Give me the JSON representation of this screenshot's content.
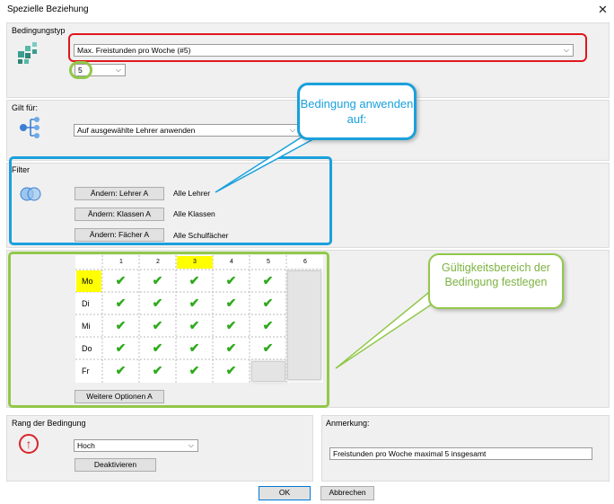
{
  "window": {
    "title": "Spezielle Beziehung",
    "close_glyph": "✕"
  },
  "bedingungstyp": {
    "label": "Bedingungstyp",
    "selected": "Max. Freistunden pro Woche (#5)",
    "value": "5"
  },
  "gilt_fuer": {
    "label": "Gilt für:",
    "selected": "Auf ausgewählte Lehrer anwenden"
  },
  "filter": {
    "label": "Filter",
    "rows": [
      {
        "button": "Ändern: Lehrer A",
        "value": "Alle Lehrer"
      },
      {
        "button": "Ändern: Klassen A",
        "value": "Alle Klassen"
      },
      {
        "button": "Ändern: Fächer A",
        "value": "Alle Schulfächer"
      }
    ]
  },
  "grid": {
    "periods": [
      "1",
      "2",
      "3",
      "4",
      "5",
      "6"
    ],
    "highlight_period": "3",
    "days": [
      "Mo",
      "Di",
      "Mi",
      "Do",
      "Fr"
    ],
    "highlight_day": "Mo",
    "check_glyph": "✔",
    "checks": [
      [
        true,
        true,
        true,
        true,
        true,
        false
      ],
      [
        true,
        true,
        true,
        true,
        true,
        false
      ],
      [
        true,
        true,
        true,
        true,
        true,
        false
      ],
      [
        true,
        true,
        true,
        true,
        true,
        false
      ],
      [
        true,
        true,
        true,
        true,
        false,
        false
      ]
    ],
    "more_options": "Weitere Optionen A"
  },
  "rang": {
    "label": "Rang der Bedingung",
    "selected": "Hoch",
    "deactivate": "Deaktivieren",
    "icon_glyph": "↑"
  },
  "anmerkung": {
    "label": "Anmerkung:",
    "value": "Freistunden pro Woche maximal 5 insgesamt"
  },
  "footer": {
    "ok": "OK",
    "cancel": "Abbrechen"
  },
  "callouts": {
    "blue": "Bedingung anwenden auf:",
    "green": "Gültigkeitsbereich der Bedingung festlegen"
  },
  "colors": {
    "highlight": "#ffff00",
    "check": "#2fab1d",
    "red": "#e0161e",
    "blue": "#1aa0dc",
    "green": "#92c84a",
    "callout_blue_text": "#1aa0dc",
    "callout_green_text": "#7db241"
  }
}
